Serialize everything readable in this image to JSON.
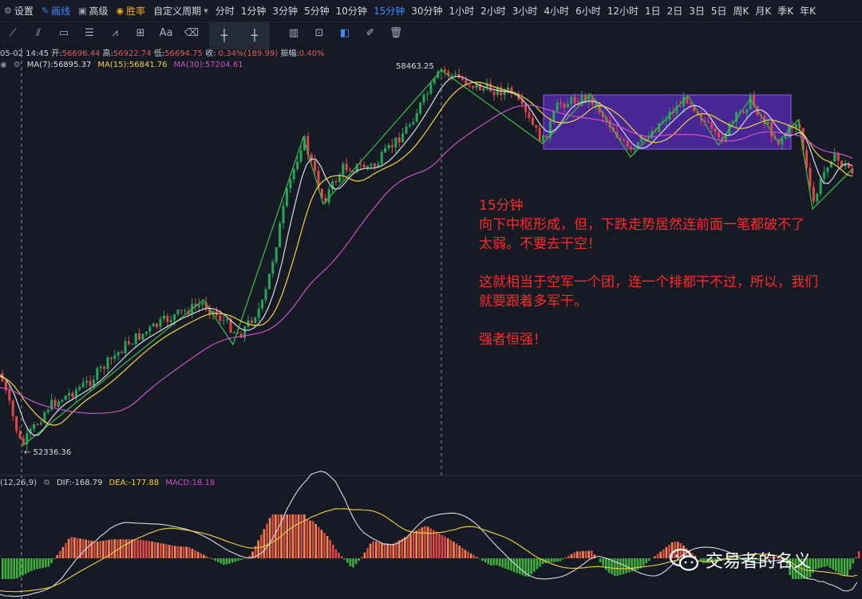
{
  "topbar": {
    "settings_label": "设置",
    "draw_label": "画线",
    "advanced_label": "高级",
    "winrate_label": "胜率",
    "custom_period_label": "自定义周期",
    "periods": [
      "分时",
      "1分钟",
      "3分钟",
      "5分钟",
      "10分钟",
      "15分钟",
      "30分钟",
      "1小时",
      "2小时",
      "3小时",
      "4小时",
      "6小时",
      "12小时",
      "1日",
      "2日",
      "3日",
      "5日",
      "周K",
      "月K",
      "季K",
      "年K"
    ],
    "active_period": "15分钟"
  },
  "ohlc": {
    "time": "05-02 14:45",
    "open_label": "开:",
    "open": "56696.44",
    "high_label": "高:",
    "high": "56922.74",
    "low_label": "低:",
    "low": "56694.75",
    "close_label": "收:",
    "change": "0.34%(189.99)",
    "amp_label": "振幅:",
    "amp": "0.40%"
  },
  "ma": {
    "ma7": "MA(7):56895.37",
    "ma15": "MA(15):56841.76",
    "ma30": "MA(30):57204.61"
  },
  "chart_labels": {
    "high_price": "58463.25",
    "low_price": "← 52336.36"
  },
  "annotation": {
    "line1": "15分钟",
    "line2": "向下中枢形成，但，下跌走势居然连前面一笔都破不了",
    "line3": "太弱。不要去干空！",
    "line4": "这就相当于空军一个团，连一个排都干不过，所以，我们",
    "line5": "就要跟着多军干。",
    "line6": "强者恒强！"
  },
  "macd": {
    "params": "(12,26,9)",
    "dif": "DIF:-168.79",
    "dea": "DEA:-177.88",
    "macd": "MACD:18.18"
  },
  "watermark": "交易者的名义",
  "colors": {
    "background": "#161a25",
    "up": "#26a65b",
    "down": "#e04848",
    "active": "#3d8bff",
    "annotation": "#ff2a2a",
    "zhongshu_box": "#6a2fd0"
  }
}
